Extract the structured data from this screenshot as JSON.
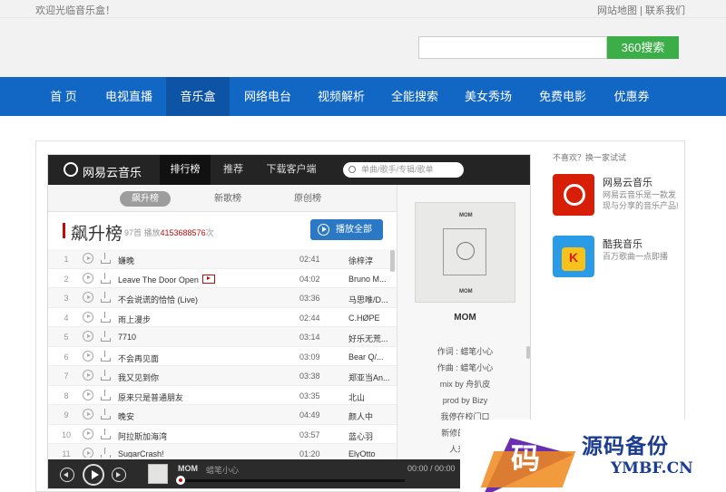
{
  "topbar": {
    "welcome": "欢迎光临音乐盒！",
    "sitemap": "网站地图",
    "separator": "|",
    "contact": "联系我们"
  },
  "search": {
    "value": "",
    "button": "360搜索"
  },
  "nav": [
    "首 页",
    "电视直播",
    "音乐盒",
    "网络电台",
    "视频解析",
    "全能搜索",
    "美女秀场",
    "免费电影",
    "优惠券"
  ],
  "nav_active": "音乐盒",
  "player": {
    "brand": "网易云音乐",
    "tabs": [
      "排行榜",
      "推荐",
      "下载客户端"
    ],
    "search_placeholder": "单曲/歌手/专辑/歌单",
    "subtabs": [
      "飙升榜",
      "新歌榜",
      "原创榜"
    ],
    "list_title": "飙升榜",
    "meta_prefix": "97首 播放",
    "play_count": "4153688576",
    "meta_suffix": "次",
    "play_all": "播放全部",
    "songs": [
      {
        "no": "1",
        "name": "嫌晚",
        "mv": false,
        "time": "02:41",
        "artist": "徐梓淳"
      },
      {
        "no": "2",
        "name": "Leave The Door Open",
        "mv": true,
        "time": "04:02",
        "artist": "Bruno M..."
      },
      {
        "no": "3",
        "name": "不会说谎的恰恰 (Live)",
        "mv": false,
        "time": "03:36",
        "artist": "马思唯/D..."
      },
      {
        "no": "4",
        "name": "雨上漫步",
        "mv": false,
        "time": "02:44",
        "artist": "C.HØPE"
      },
      {
        "no": "5",
        "name": "7710",
        "mv": false,
        "time": "03:14",
        "artist": "好乐无荒..."
      },
      {
        "no": "6",
        "name": "不会再见面",
        "mv": false,
        "time": "03:09",
        "artist": "Bear Q/..."
      },
      {
        "no": "7",
        "name": "我又见到你",
        "mv": false,
        "time": "03:38",
        "artist": "郑亚当An..."
      },
      {
        "no": "8",
        "name": "原来只是普通朋友",
        "mv": false,
        "time": "03:35",
        "artist": "北山"
      },
      {
        "no": "9",
        "name": "晚安",
        "mv": false,
        "time": "04:49",
        "artist": "颜人中"
      },
      {
        "no": "10",
        "name": "阿拉斯加海湾",
        "mv": false,
        "time": "03:57",
        "artist": "蓝心羽"
      },
      {
        "no": "11",
        "name": "SugarCrash!",
        "mv": false,
        "time": "01:20",
        "artist": "ElyOtto"
      }
    ],
    "now": {
      "cover_text": "MOM",
      "title": "MOM",
      "artist": "蜡笔小心",
      "time": "00:00 / 00:00",
      "progress": 0
    },
    "lyrics": [
      "作词 : 蜡笔小心",
      "作曲 : 蜡笔小心",
      "mix by 舟扒皮",
      "prod by Bizy",
      "我停在校门口",
      "新修的那条...",
      "人来人..."
    ]
  },
  "sidebar": {
    "title": "不喜欢？换一家试试",
    "apps": [
      {
        "name": "网易云音乐",
        "desc": "网易云音乐是一款发现与分享的音乐产品!",
        "icon": "netease-music-icon"
      },
      {
        "name": "酷我音乐",
        "desc": "百万歌曲一点即播",
        "icon": "kuwo-music-icon"
      }
    ]
  },
  "watermark": {
    "glyph": "码",
    "text1": "源码备份",
    "text2": "YMBF.CN"
  },
  "colors": {
    "nav_bg": "#1266c4",
    "search_btn": "#3cae48",
    "player_dark": "#242424",
    "accent_red": "#c20c0c",
    "play_all_btn": "#2b78c5"
  }
}
